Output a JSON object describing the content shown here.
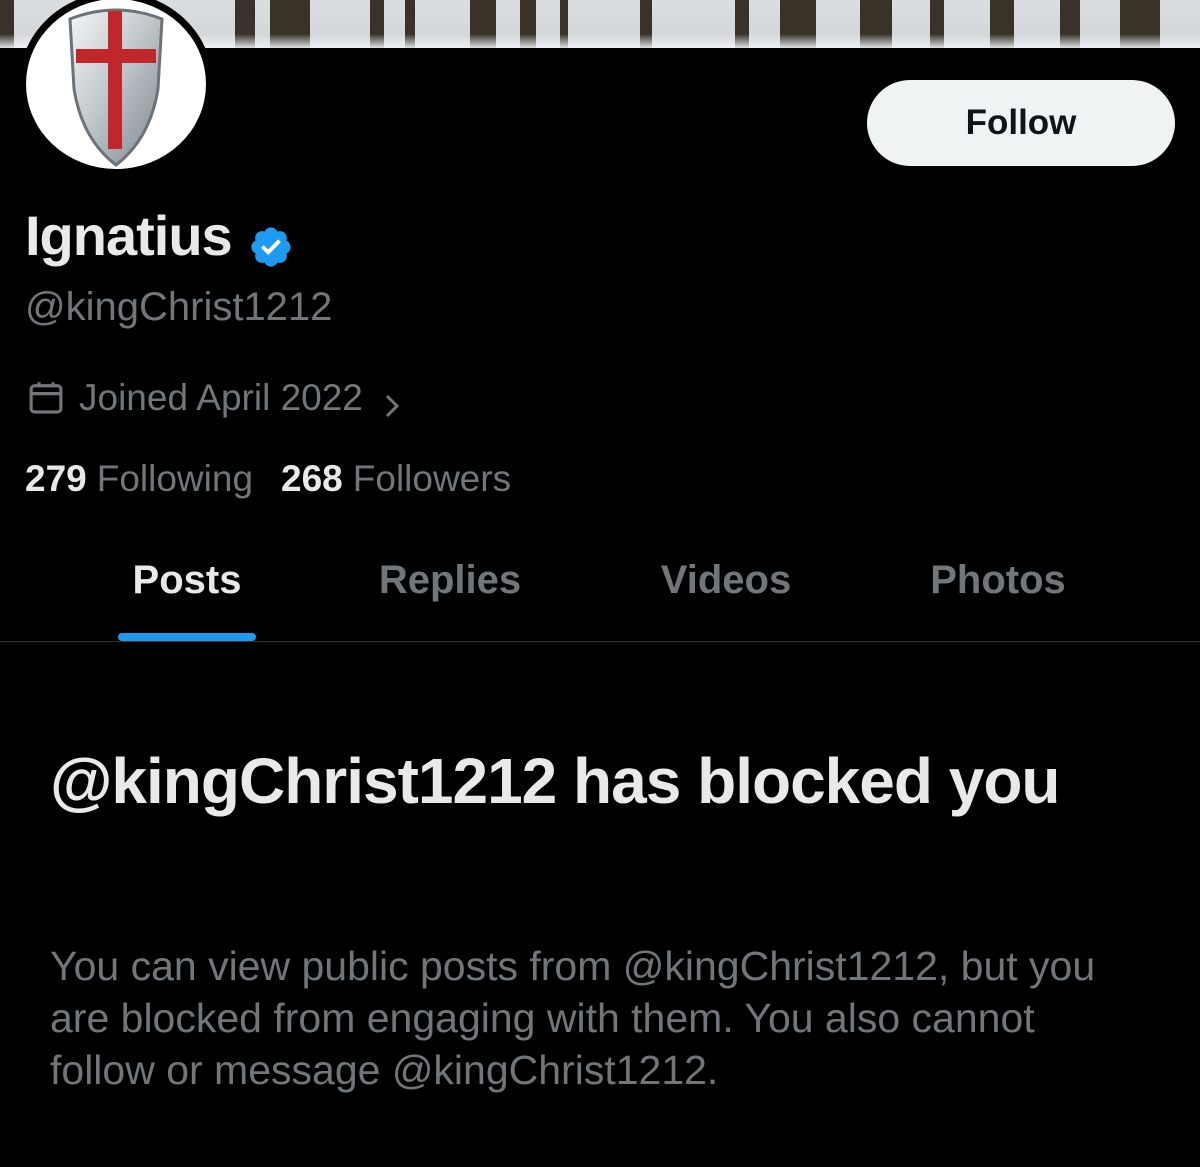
{
  "profile": {
    "display_name": "Ignatius",
    "handle": "@kingChrist1212",
    "joined": "Joined April 2022",
    "following_count": "279",
    "following_label": "Following",
    "followers_count": "268",
    "followers_label": "Followers",
    "verified_color": "#1d9bf0",
    "avatar_icon": "templar-shield-icon"
  },
  "actions": {
    "follow_label": "Follow"
  },
  "tabs": [
    {
      "label": "Posts",
      "active": true
    },
    {
      "label": "Replies",
      "active": false
    },
    {
      "label": "Videos",
      "active": false
    },
    {
      "label": "Photos",
      "active": false
    }
  ],
  "blocked": {
    "title": "@kingChrist1212 has blocked you",
    "description": "You can view public posts from @kingChrist1212, but you are blocked from engaging with them. You also cannot follow or message @kingChrist1212."
  },
  "colors": {
    "background": "#000000",
    "primary_text": "#e7e9ea",
    "secondary_text": "#71767b",
    "accent": "#1d9bf0"
  }
}
